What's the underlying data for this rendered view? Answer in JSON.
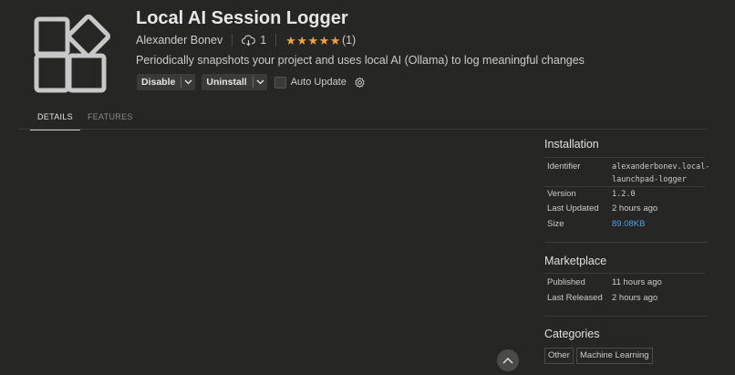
{
  "header": {
    "icon": "extension-grid-icon",
    "title": "Local AI Session Logger",
    "publisher": "Alexander Bonev",
    "install_count": "1",
    "rating_stars": 5,
    "rating_count": "(1)",
    "description": "Periodically snapshots your project and uses local AI (Ollama) to log meaningful changes"
  },
  "actions": {
    "disable_label": "Disable",
    "uninstall_label": "Uninstall",
    "auto_update_label": "Auto Update",
    "auto_update_checked": false
  },
  "tabs": [
    {
      "label": "DETAILS",
      "active": true
    },
    {
      "label": "FEATURES",
      "active": false
    }
  ],
  "installation": {
    "title": "Installation",
    "rows": [
      {
        "key": "Identifier",
        "value_line1": "alexanderbonev.local-",
        "value_line2": "launchpad-logger"
      },
      {
        "key": "Version",
        "value": "1.2.0"
      },
      {
        "key": "Last Updated",
        "value": "2 hours ago"
      },
      {
        "key": "Size",
        "value": "89.08KB"
      }
    ]
  },
  "marketplace": {
    "title": "Marketplace",
    "rows": [
      {
        "key": "Published",
        "value": "11 hours ago"
      },
      {
        "key": "Last Released",
        "value": "2 hours ago"
      }
    ]
  },
  "categories": {
    "title": "Categories",
    "tags": [
      "Other",
      "Machine Learning"
    ]
  },
  "colors": {
    "background": "#262624",
    "star": "#f0a23b",
    "link": "#4d9fe6"
  }
}
